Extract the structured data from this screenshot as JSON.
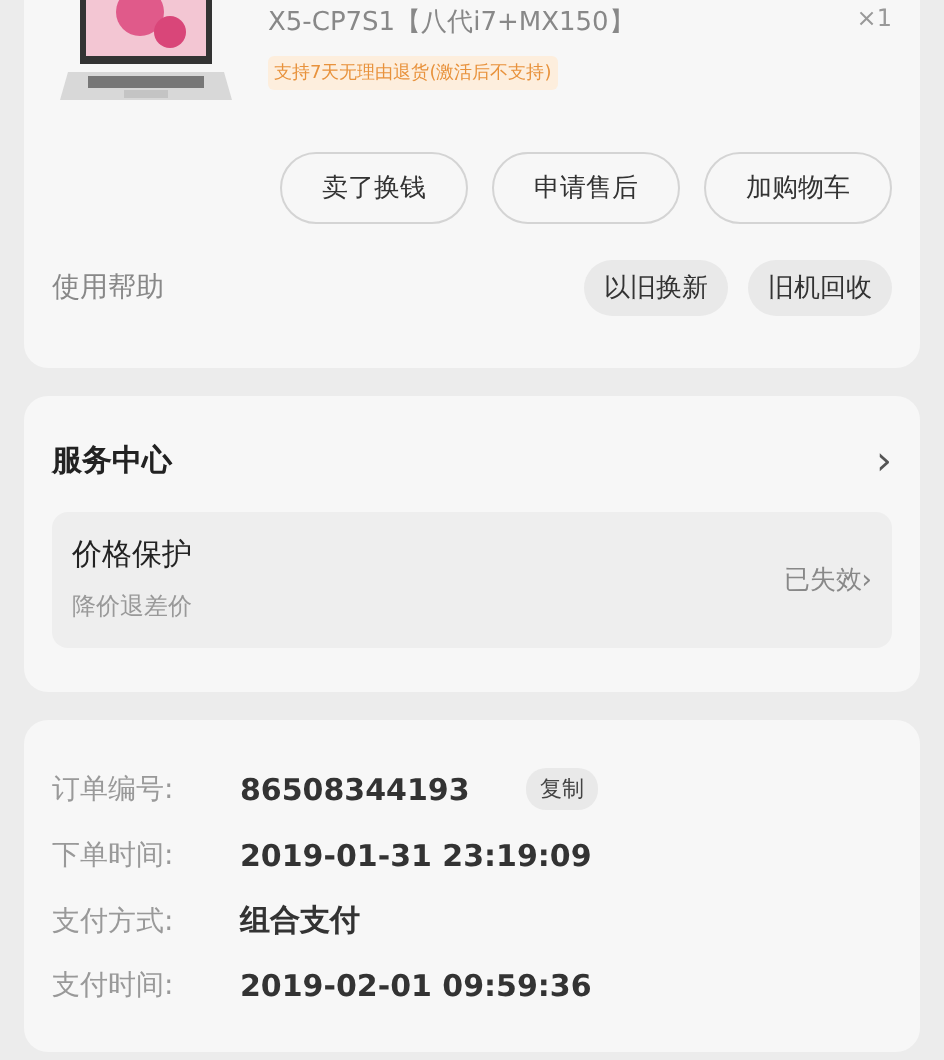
{
  "product": {
    "kind": "picture",
    "spec": "X5-CP7S1【八代i7+MX150】",
    "quantity": "×1",
    "tag": "支持7天无理由退货(激活后不支持)"
  },
  "actions": [
    "卖了换钱",
    "申请售后",
    "加购物车"
  ],
  "help": {
    "label": "使用帮助",
    "links": [
      "以旧换新",
      "旧机回收"
    ]
  },
  "service": {
    "title": "服务中心",
    "chevron": "›",
    "item": {
      "title": "价格保护",
      "subtitle": "降价退差价",
      "status": "已失效›"
    }
  },
  "order": [
    {
      "label": "订单编号:",
      "value": "86508344193",
      "action": "复制"
    },
    {
      "label": "下单时间:",
      "value": "2019-01-31 23:19:09"
    },
    {
      "label": "支付方式:",
      "value": "组合支付"
    },
    {
      "label": "支付时间:",
      "value": "2019-02-01 09:59:36"
    }
  ]
}
